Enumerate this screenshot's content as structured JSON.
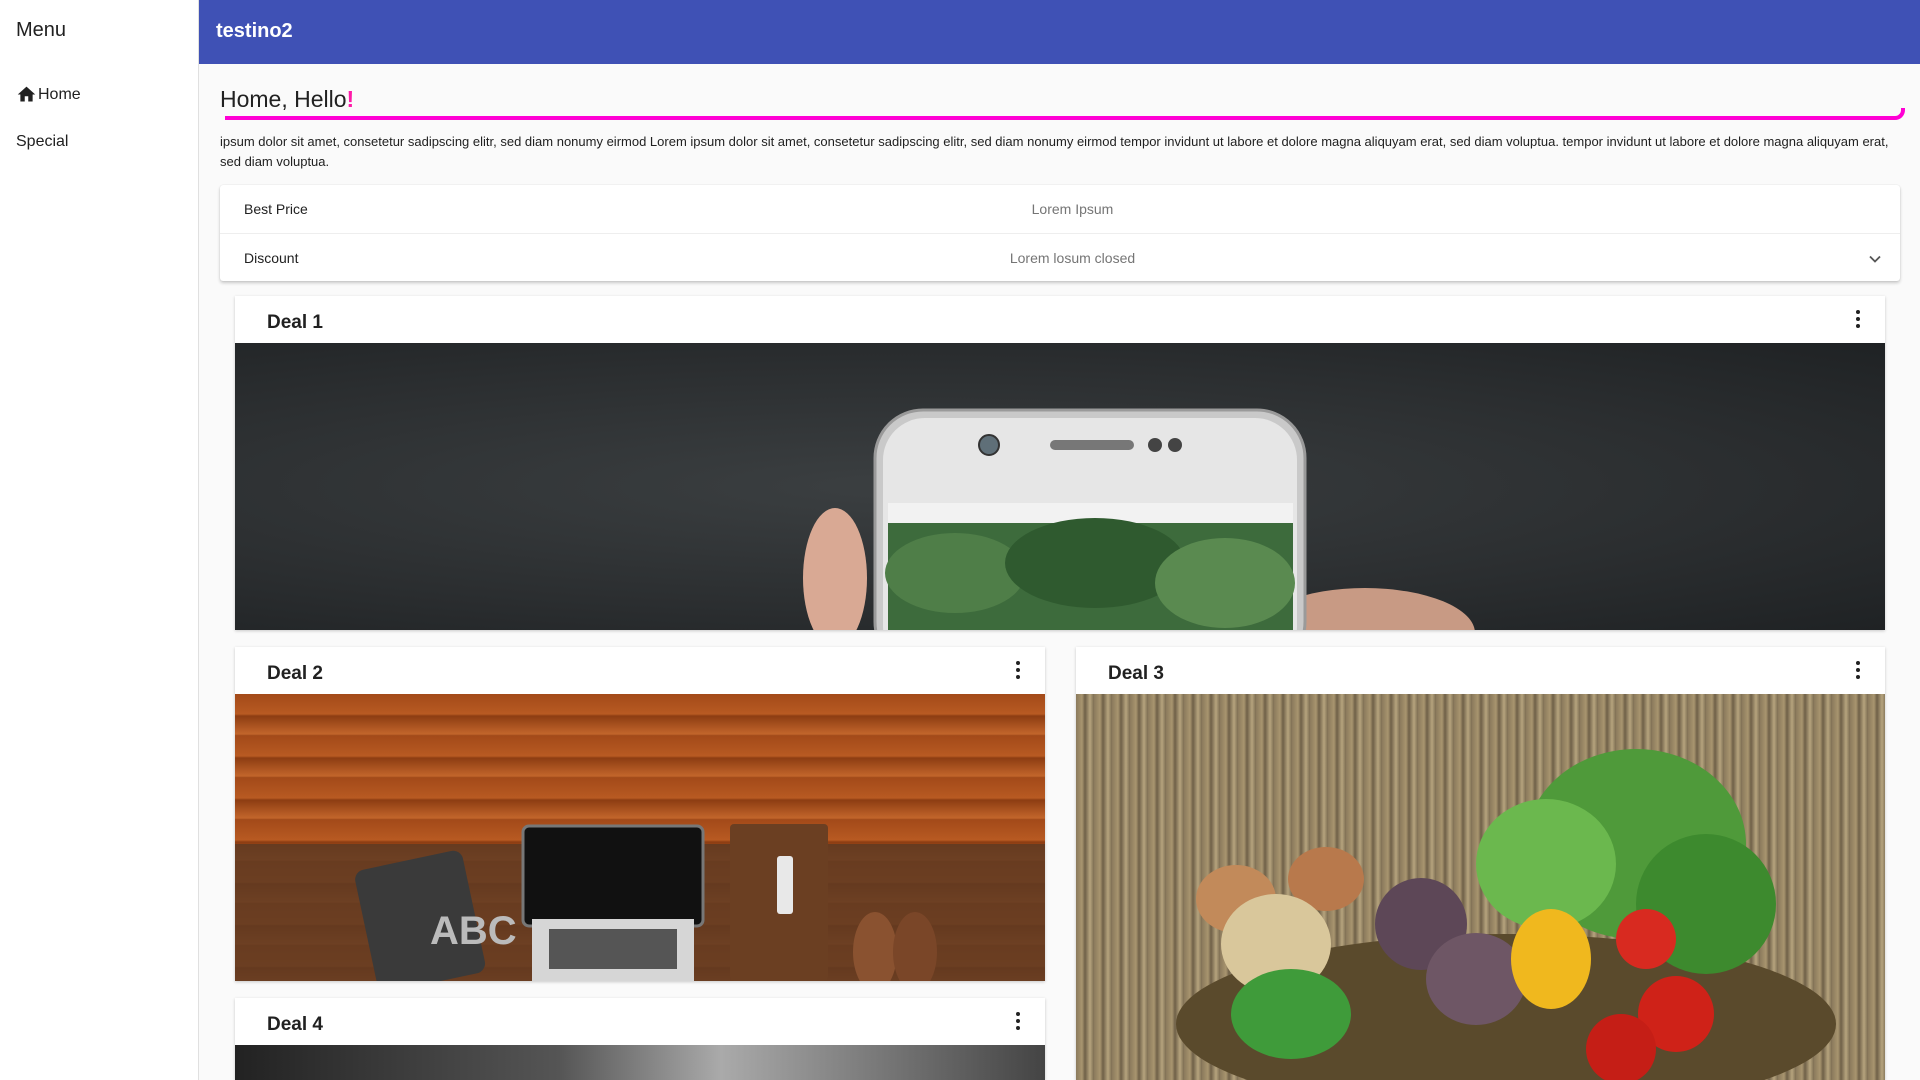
{
  "sidebar": {
    "title": "Menu",
    "items": [
      {
        "label": "Home",
        "icon": "home-icon"
      },
      {
        "label": "Special"
      }
    ]
  },
  "toolbar": {
    "title": "testino2",
    "color": "#3f51b5"
  },
  "main": {
    "greeting": "Home, Hello!",
    "greeting_accent": "!",
    "accent_color": "#ff00d4",
    "paragraph": "ipsum dolor sit amet, consetetur sadipscing elitr, sed diam nonumy eirmod Lorem ipsum dolor sit amet, consetetur sadipscing elitr, sed diam nonumy eirmod tempor invidunt ut labore et dolore magna aliquyam erat, sed diam voluptua. tempor invidunt ut labore et dolore magna aliquyam erat, sed diam voluptua."
  },
  "panel": {
    "rows": [
      {
        "label": "Best Price",
        "description": "Lorem Ipsum"
      },
      {
        "label": "Discount",
        "description": "Lorem losum closed"
      }
    ]
  },
  "cards": [
    {
      "title": "Deal 1"
    },
    {
      "title": "Deal 2"
    },
    {
      "title": "Deal 3"
    },
    {
      "title": "Deal 4"
    }
  ]
}
